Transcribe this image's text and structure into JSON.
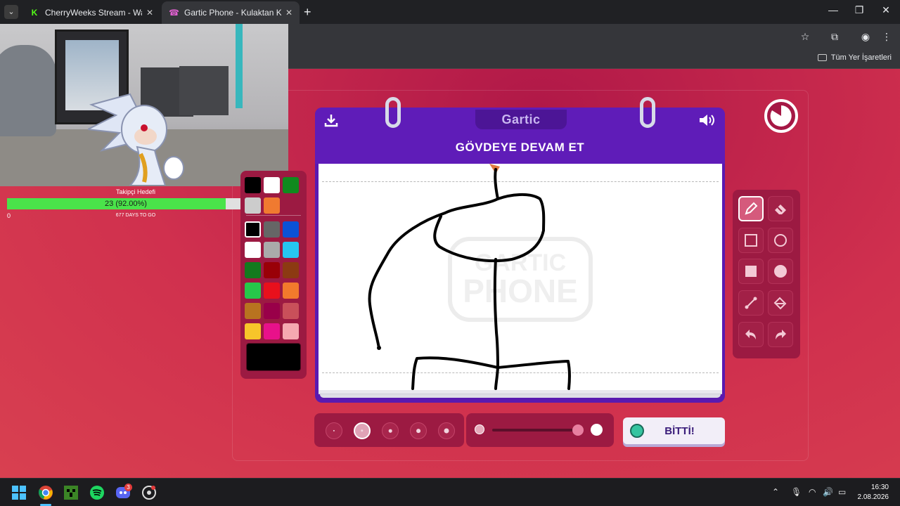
{
  "browser": {
    "tabs": [
      {
        "title": "CherryWeeks Stream - Watch Li",
        "favicon": "K",
        "favicon_color": "#53fc18"
      },
      {
        "title": "Gartic Phone - Kulaktan Kulağa",
        "favicon": "☎",
        "favicon_color": "#e060d0"
      }
    ],
    "bookmark_folder": "Tüm Yer İşaretleri"
  },
  "overlay": {
    "goal_label": "Takipçi Hedefi",
    "goal_text": "23 (92.00%)",
    "goal_progress": 0.92,
    "goal_min": "0",
    "goal_max": "25",
    "goal_days": "677 DAYS TO GO"
  },
  "game": {
    "logo": "Gartic",
    "title": "GÖVDEYE DEVAM ET",
    "done_label": "BİTTİ!",
    "watermark": "GARTIC PHONE",
    "palette_top": [
      "#000000",
      "#ffffff",
      "#108a1e",
      "#cccccc",
      "#f07a30"
    ],
    "palette": [
      "#000000",
      "#666666",
      "#0b52d6",
      "#ffffff",
      "#aaaaaa",
      "#26c6f0",
      "#137a1e",
      "#990007",
      "#8c3a12",
      "#26c84a",
      "#e8101c",
      "#f27a2c",
      "#b87320",
      "#990049",
      "#c9505a",
      "#f7c52a",
      "#e8118a",
      "#f5a8b0"
    ],
    "current_color": "#000000",
    "brush_sizes": [
      1,
      2,
      3,
      4,
      5
    ],
    "selected_brush_size": 2,
    "selected_tool": "pencil",
    "opacity_level": 0.9
  },
  "taskbar": {
    "discord_badge": "3",
    "time": "16:30",
    "date": "2.08.2026"
  }
}
